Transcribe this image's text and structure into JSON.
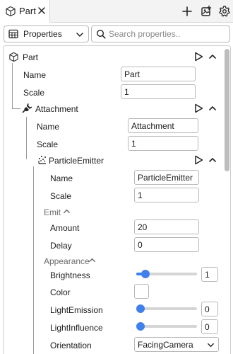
{
  "tab": {
    "title": "Part"
  },
  "toolbar": {
    "view_label": "Properties",
    "search_placeholder": "Search properties.."
  },
  "tree": {
    "part": {
      "label": "Part",
      "name_label": "Name",
      "name_value": "Part",
      "scale_label": "Scale",
      "scale_value": "1"
    },
    "attachment": {
      "label": "Attachment",
      "name_label": "Name",
      "name_value": "Attachment",
      "scale_label": "Scale",
      "scale_value": "1"
    },
    "emitter": {
      "label": "ParticleEmitter",
      "name_label": "Name",
      "name_value": "ParticleEmitter",
      "scale_label": "Scale",
      "scale_value": "1",
      "emit": {
        "label": "Emit",
        "amount_label": "Amount",
        "amount_value": "20",
        "delay_label": "Delay",
        "delay_value": "0"
      },
      "appearance": {
        "label": "Appearance",
        "brightness_label": "Brightness",
        "brightness_value": "1",
        "brightness_fraction": 0.15,
        "color_label": "Color",
        "color_value": "#ffffff",
        "light_emission_label": "LightEmission",
        "light_emission_value": "0",
        "light_emission_fraction": 0,
        "light_influence_label": "LightInfluence",
        "light_influence_value": "0",
        "light_influence_fraction": 0,
        "orientation_label": "Orientation",
        "orientation_value": "FacingCamera"
      }
    }
  },
  "colors": {
    "accent": "#3f80ea"
  }
}
